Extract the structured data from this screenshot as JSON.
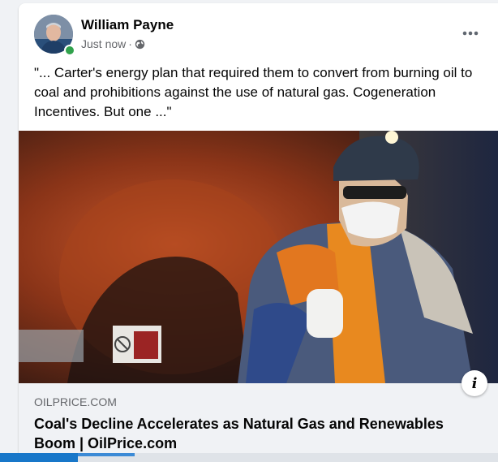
{
  "post": {
    "author": "William Payne",
    "timestamp": "Just now",
    "separator": "·",
    "audience_icon": "globe-icon",
    "text": "\"... Carter's energy plan that required them to convert from burning oil to coal and prohibitions against the use of natural gas. Cogeneration Incentives. But one ...\"",
    "more_icon": "more-horizontal-icon"
  },
  "link_preview": {
    "domain": "OILPRICE.COM",
    "title": "Coal's Decline Accelerates as Natural Gas and Renewables Boom | OilPrice.com",
    "info_label": "i"
  },
  "colors": {
    "card": "#ffffff",
    "page_background": "#f0f2f5",
    "online_status": "#31a24c",
    "secondary_text": "#65676b"
  }
}
